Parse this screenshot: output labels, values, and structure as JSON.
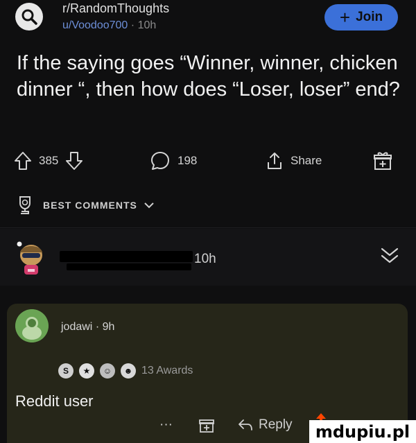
{
  "post": {
    "subreddit": "r/RandomThoughts",
    "author": "u/Voodoo700",
    "separator": "·",
    "age": "10h",
    "join_label": "Join",
    "title": "If the saying goes “Winner, winner, chicken dinner “, then how does “Loser, loser” end?"
  },
  "actions": {
    "upvotes": "385",
    "comments": "198",
    "share_label": "Share"
  },
  "comments_header": {
    "sort_label": "BEST COMMENTS"
  },
  "collapsed_comment": {
    "age": "10h"
  },
  "reply": {
    "author": "jodawi",
    "separator": "·",
    "age": "9h",
    "awards_label": "13 Awards",
    "body": "Reddit user",
    "more_label": "···",
    "reply_label": "Reply"
  },
  "watermark": {
    "text": "mdupiu.pl"
  },
  "colors": {
    "background": "#0f0f10",
    "accent": "#3b70d9",
    "reply_card": "#262619"
  }
}
